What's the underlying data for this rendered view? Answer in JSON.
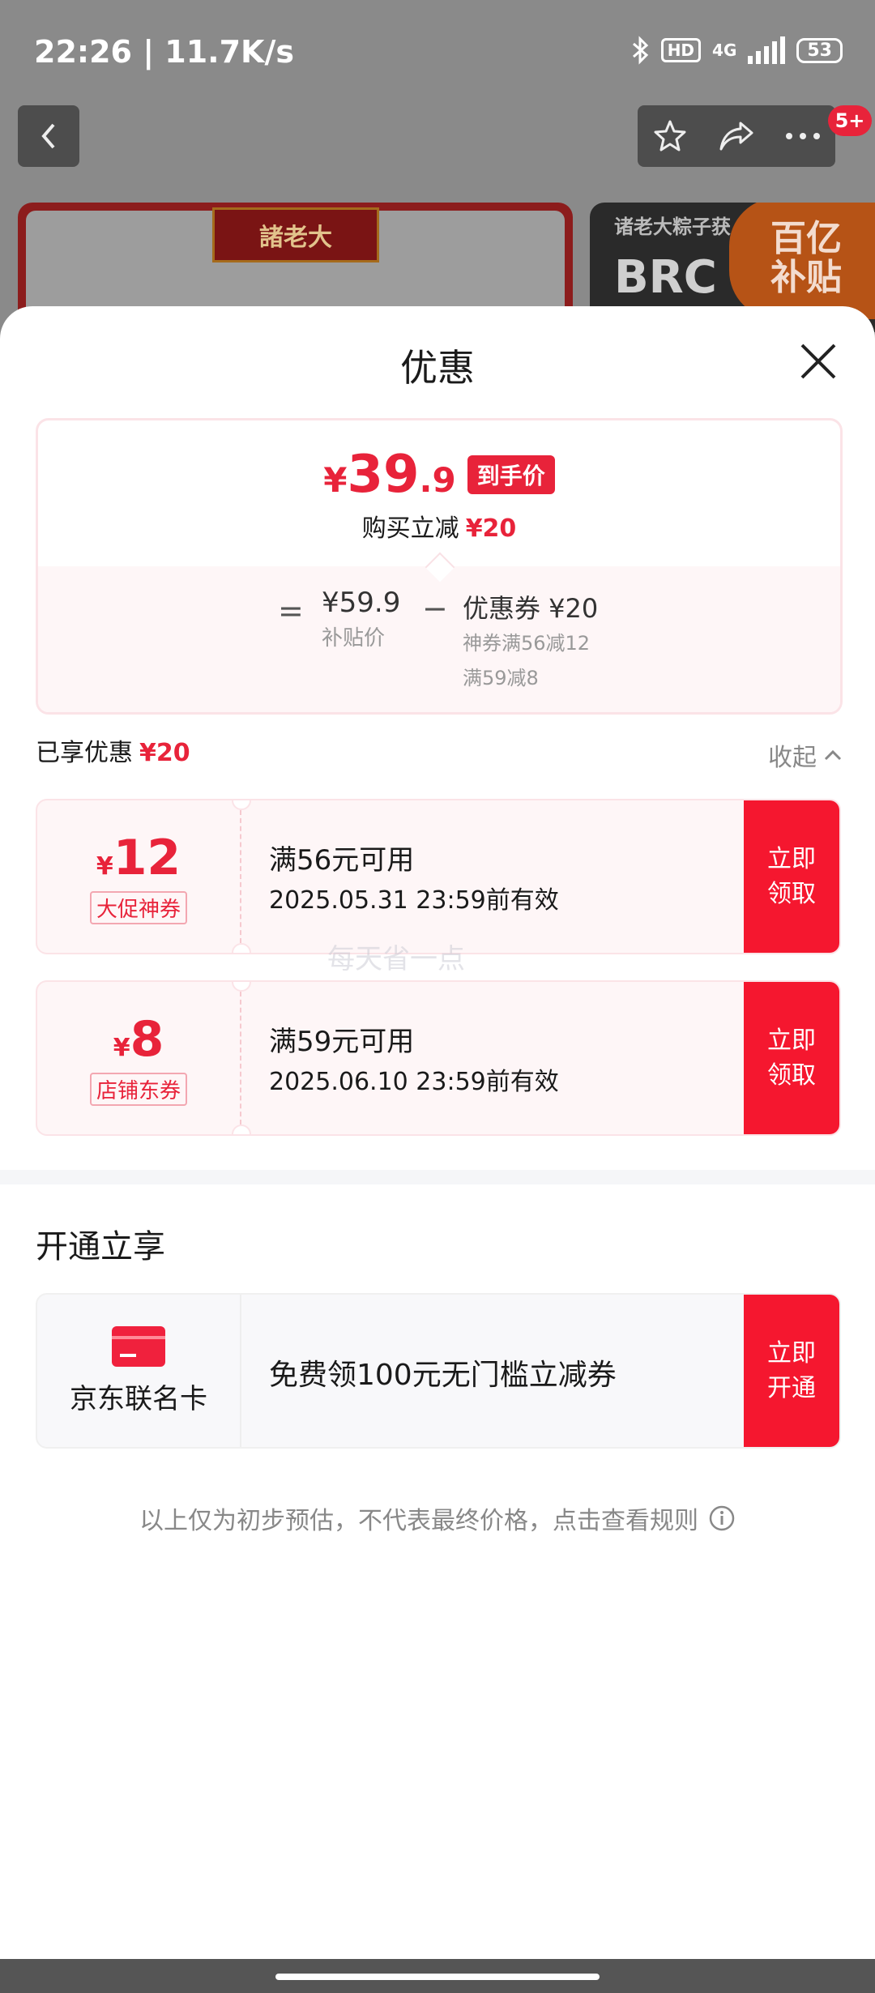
{
  "status": {
    "time": "22:26 | 11.7K/s",
    "hd": "HD",
    "net": "4G",
    "battery": "53"
  },
  "nav": {
    "badge": "5+"
  },
  "banner": {
    "left_logo": "諸老大",
    "right_line1": "诸老大粽子获",
    "right_line2": "BRC",
    "right_sub1": "百亿",
    "right_sub2": "补贴"
  },
  "sheet": {
    "title": "优惠",
    "price": {
      "currency": "¥",
      "integer": "39",
      "decimal": ".9",
      "tag": "到手价",
      "save_label": "购买立减",
      "save_amount": "¥20",
      "equals": "=",
      "subsidy_price": "¥59.9",
      "subsidy_label": "补贴价",
      "minus": "−",
      "coupon_total": "优惠券 ¥20",
      "coupon_detail_1": "神券满56减12",
      "coupon_detail_2": "满59减8"
    },
    "enjoyed": {
      "label": "已享优惠",
      "amount": "¥20"
    },
    "collapse_label": "收起",
    "coupons": [
      {
        "currency": "¥",
        "amount": "12",
        "type": "大促神券",
        "condition": "满56元可用",
        "validity": "2025.05.31 23:59前有效",
        "claim_line1": "立即",
        "claim_line2": "领取"
      },
      {
        "currency": "¥",
        "amount": "8",
        "type": "店铺东券",
        "condition": "满59元可用",
        "validity": "2025.06.10 23:59前有效",
        "claim_line1": "立即",
        "claim_line2": "领取"
      }
    ],
    "watermark": "每天省一点",
    "join": {
      "title": "开通立享",
      "card_name": "京东联名卡",
      "offer": "免费领100元无门槛立减券",
      "action_line1": "立即",
      "action_line2": "开通"
    },
    "disclaimer": "以上仅为初步预估，不代表最终价格，点击查看规则"
  },
  "colors": {
    "accent": "#e8233a",
    "claim_button": "#f5172f"
  }
}
